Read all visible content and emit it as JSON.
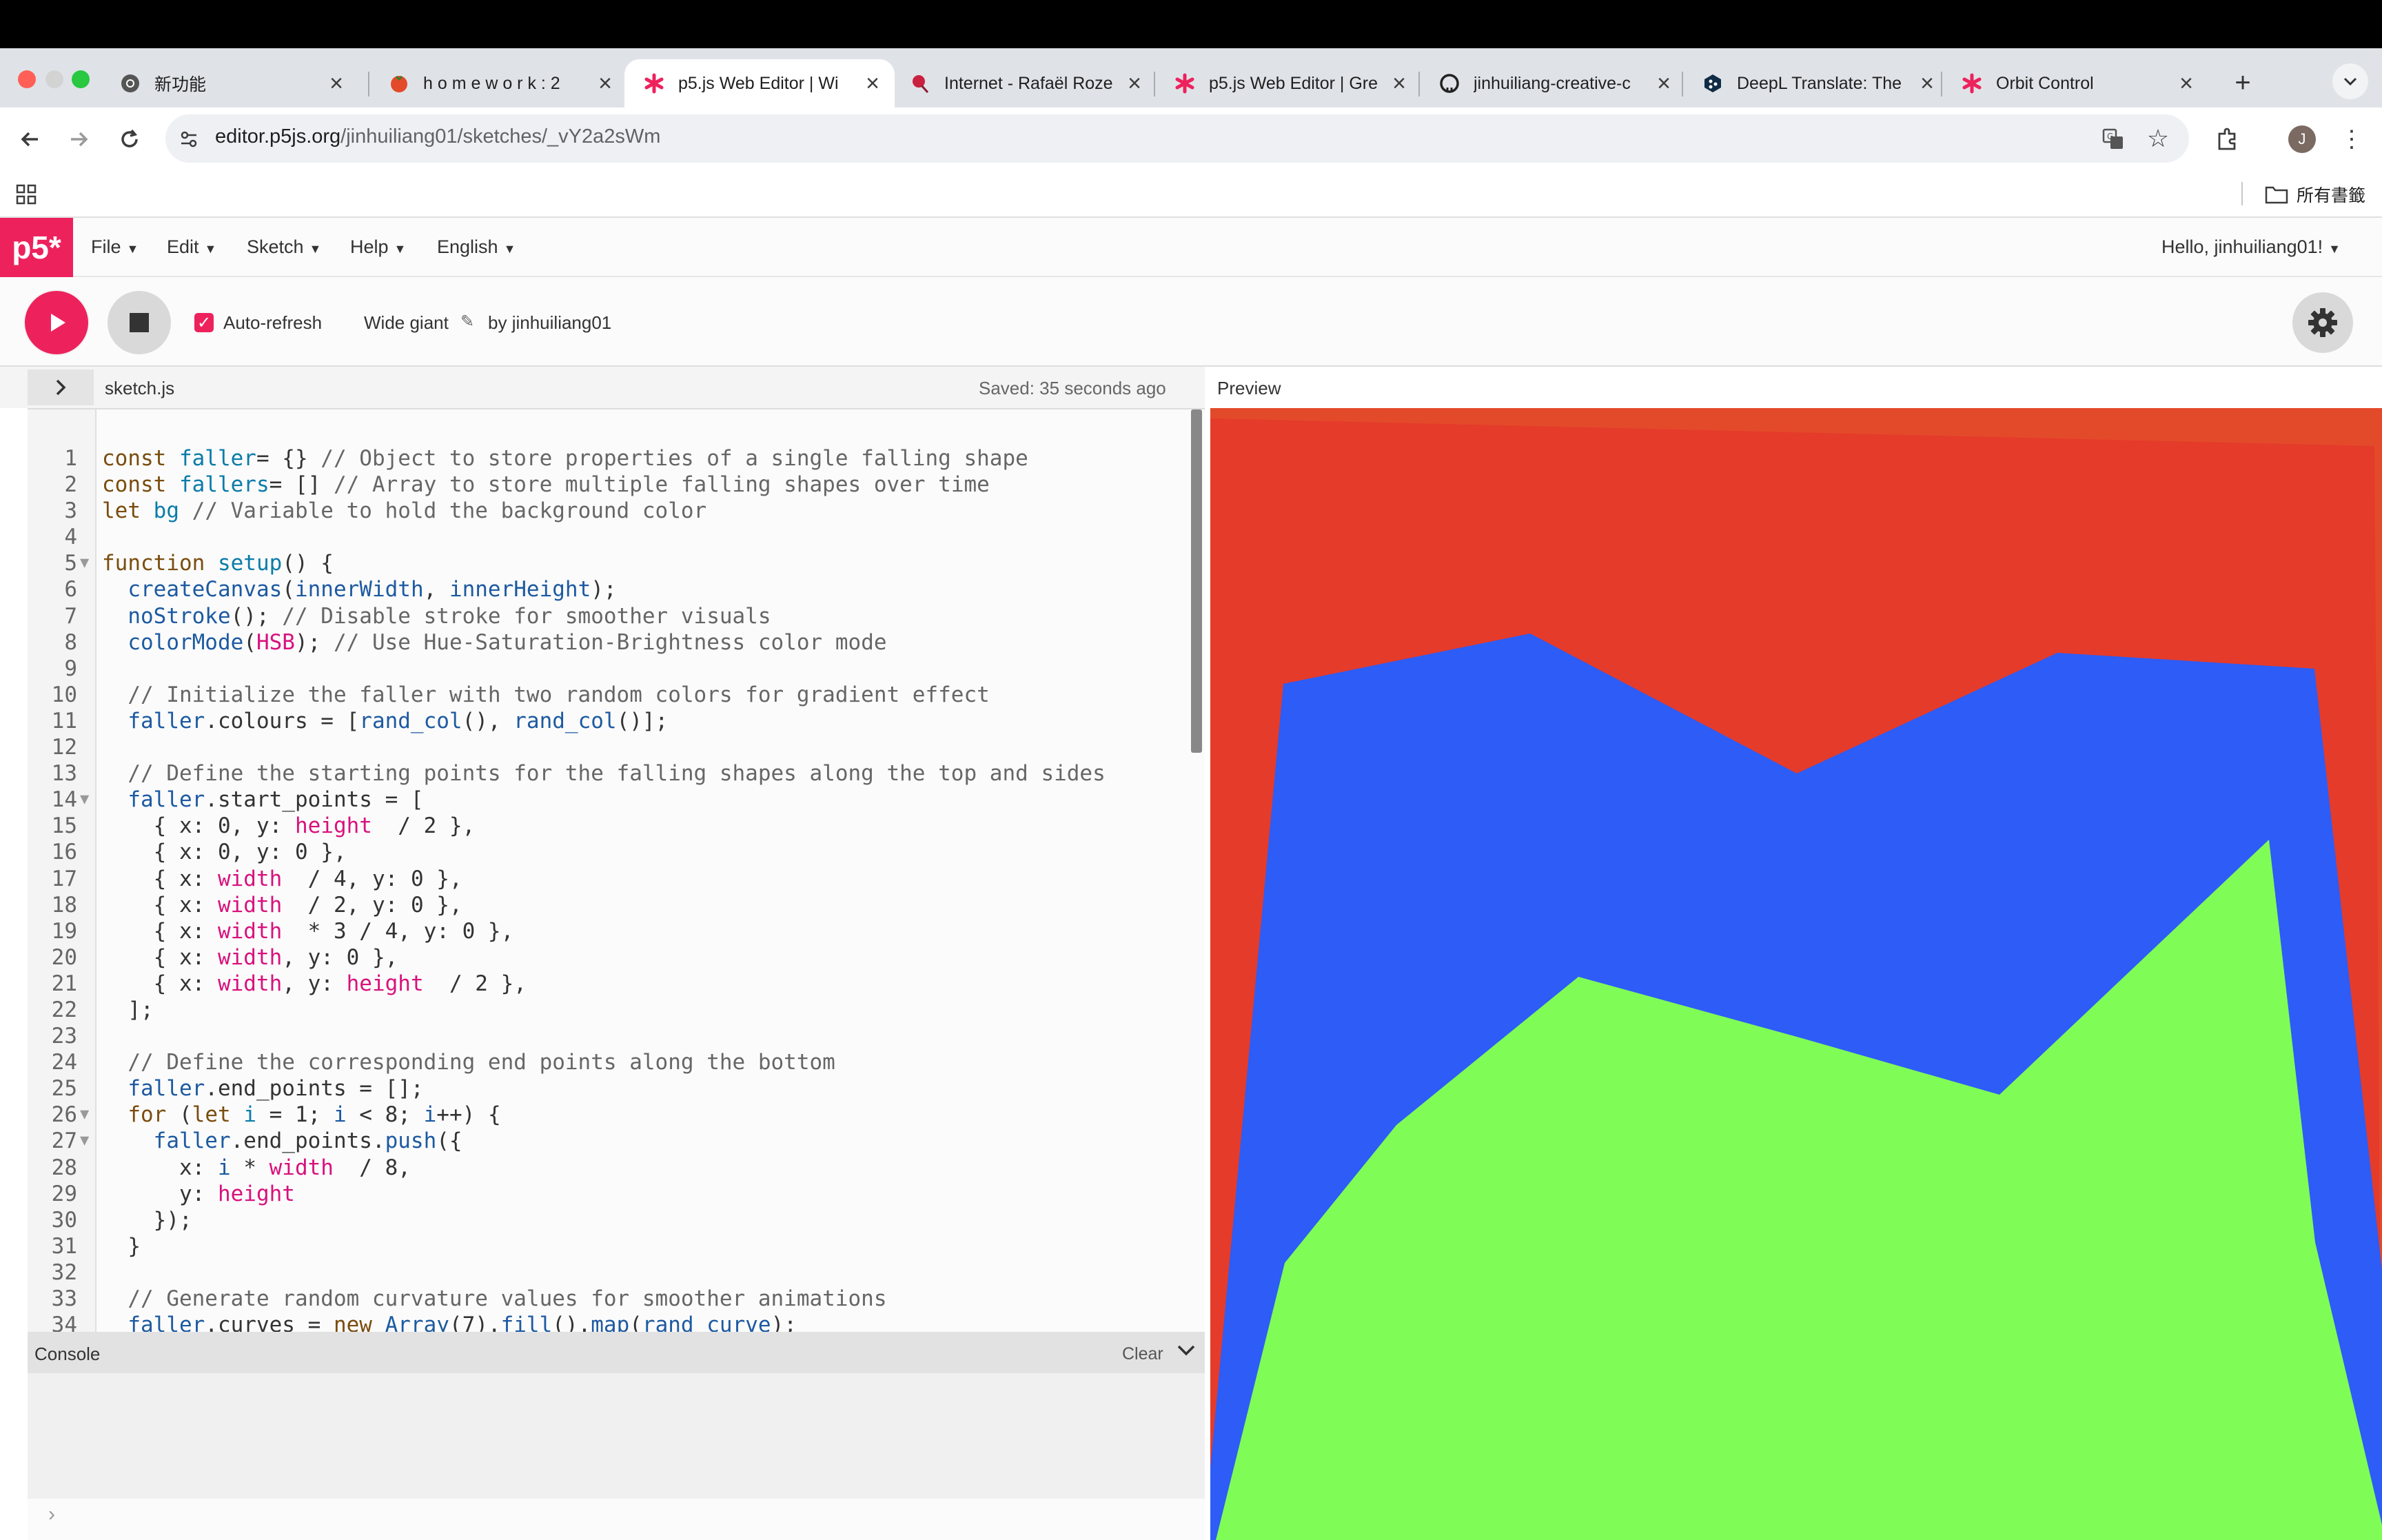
{
  "browser": {
    "tabs": [
      {
        "title": "新功能",
        "icon": "chrome-icon"
      },
      {
        "title": "h o m e w o r k : 2",
        "icon": "tomato-icon"
      },
      {
        "title": "p5.js Web Editor | Wi",
        "icon": "p5-asterisk-icon"
      },
      {
        "title": "Internet - Rafaël Roze",
        "icon": "rose-icon"
      },
      {
        "title": "p5.js Web Editor | Gre",
        "icon": "p5-asterisk-icon"
      },
      {
        "title": "jinhuiliang-creative-c",
        "icon": "github-icon"
      },
      {
        "title": "DeepL Translate: The",
        "icon": "deepl-icon"
      },
      {
        "title": "Orbit Control",
        "icon": "p5-asterisk-icon"
      }
    ],
    "active_tab_index": 2,
    "url_host": "editor.p5js.org",
    "url_path": "/jinhuiliang01/sketches/_vY2a2sWm",
    "bookmarks_label": "所有書籤",
    "profile_initial": "J",
    "colors": {
      "close": "#ff5f57",
      "minimize": "#d3d3d3",
      "maximize": "#28c840",
      "p5_pink": "#ed225d"
    }
  },
  "editor": {
    "logo": "p5*",
    "menus": [
      "File",
      "Edit",
      "Sketch",
      "Help",
      "English"
    ],
    "user_menu": "Hello, jinhuiliang01!",
    "auto_refresh_label": "Auto-refresh",
    "auto_refresh_checked": true,
    "sketch_name": "Wide giant",
    "by_label": "by",
    "author": "jinhuiliang01",
    "file_name": "sketch.js",
    "saved_status": "Saved: 35 seconds ago",
    "preview_label": "Preview",
    "console_label": "Console",
    "clear_label": "Clear",
    "fold_marker_lines": [
      5,
      14,
      26,
      27
    ],
    "code_lines": [
      [
        [
          "kw",
          "const "
        ],
        [
          "def",
          "faller"
        ],
        [
          "",
          "= {} "
        ],
        [
          "cm",
          "// Object to store properties of a single falling shape"
        ]
      ],
      [
        [
          "kw",
          "const "
        ],
        [
          "def",
          "fallers"
        ],
        [
          "",
          "= [] "
        ],
        [
          "cm",
          "// Array to store multiple falling shapes over time"
        ]
      ],
      [
        [
          "kw",
          "let "
        ],
        [
          "def",
          "bg "
        ],
        [
          "cm",
          "// Variable to hold the background color"
        ]
      ],
      [],
      [
        [
          "kw",
          "function "
        ],
        [
          "def",
          "setup"
        ],
        [
          "",
          "() {"
        ]
      ],
      [
        [
          "",
          "  "
        ],
        [
          "vr",
          "createCanvas"
        ],
        [
          "",
          "("
        ],
        [
          "vr",
          "innerWidth"
        ],
        [
          "",
          ", "
        ],
        [
          "vr",
          "innerHeight"
        ],
        [
          "",
          ");"
        ]
      ],
      [
        [
          "",
          "  "
        ],
        [
          "vr",
          "noStroke"
        ],
        [
          "",
          "(); "
        ],
        [
          "cm",
          "// Disable stroke for smoother visuals"
        ]
      ],
      [
        [
          "",
          "  "
        ],
        [
          "vr",
          "colorMode"
        ],
        [
          "",
          "("
        ],
        [
          "mg",
          "HSB"
        ],
        [
          "",
          "); "
        ],
        [
          "cm",
          "// Use Hue-Saturation-Brightness color mode"
        ]
      ],
      [],
      [
        [
          "",
          "  "
        ],
        [
          "cm",
          "// Initialize the faller with two random colors for gradient effect"
        ]
      ],
      [
        [
          "",
          "  "
        ],
        [
          "vr",
          "faller"
        ],
        [
          "",
          ".colours = ["
        ],
        [
          "vr",
          "rand_col"
        ],
        [
          "",
          "(), "
        ],
        [
          "vr",
          "rand_col"
        ],
        [
          "",
          "()];"
        ]
      ],
      [],
      [
        [
          "",
          "  "
        ],
        [
          "cm",
          "// Define the starting points for the falling shapes along the top and sides"
        ]
      ],
      [
        [
          "",
          "  "
        ],
        [
          "vr",
          "faller"
        ],
        [
          "",
          ".start_points = ["
        ]
      ],
      [
        [
          "",
          "    { x: 0, y: "
        ],
        [
          "mg",
          "height"
        ],
        [
          "",
          "  / 2 },"
        ]
      ],
      [
        [
          "",
          "    { x: 0, y: 0 },"
        ]
      ],
      [
        [
          "",
          "    { x: "
        ],
        [
          "mg",
          "width"
        ],
        [
          "",
          "  / 4, y: 0 },"
        ]
      ],
      [
        [
          "",
          "    { x: "
        ],
        [
          "mg",
          "width"
        ],
        [
          "",
          "  / 2, y: 0 },"
        ]
      ],
      [
        [
          "",
          "    { x: "
        ],
        [
          "mg",
          "width"
        ],
        [
          "",
          "  * 3 / 4, y: 0 },"
        ]
      ],
      [
        [
          "",
          "    { x: "
        ],
        [
          "mg",
          "width"
        ],
        [
          "",
          ", y: 0 },"
        ]
      ],
      [
        [
          "",
          "    { x: "
        ],
        [
          "mg",
          "width"
        ],
        [
          "",
          ", y: "
        ],
        [
          "mg",
          "height"
        ],
        [
          "",
          "  / 2 },"
        ]
      ],
      [
        [
          "",
          "  ];"
        ]
      ],
      [],
      [
        [
          "",
          "  "
        ],
        [
          "cm",
          "// Define the corresponding end points along the bottom"
        ]
      ],
      [
        [
          "",
          "  "
        ],
        [
          "vr",
          "faller"
        ],
        [
          "",
          ".end_points = [];"
        ]
      ],
      [
        [
          "",
          "  "
        ],
        [
          "kw",
          "for "
        ],
        [
          "",
          "("
        ],
        [
          "kw",
          "let "
        ],
        [
          "def",
          "i "
        ],
        [
          "",
          "= 1; "
        ],
        [
          "vr",
          "i "
        ],
        [
          "",
          "< 8; "
        ],
        [
          "vr",
          "i"
        ],
        [
          "",
          "++) {"
        ]
      ],
      [
        [
          "",
          "    "
        ],
        [
          "vr",
          "faller"
        ],
        [
          "",
          ".end_points."
        ],
        [
          "vr",
          "push"
        ],
        [
          "",
          "({"
        ]
      ],
      [
        [
          "",
          "      x: "
        ],
        [
          "vr",
          "i "
        ],
        [
          "",
          "* "
        ],
        [
          "mg",
          "width"
        ],
        [
          "",
          "  / 8,"
        ]
      ],
      [
        [
          "",
          "      y: "
        ],
        [
          "mg",
          "height"
        ]
      ],
      [
        [
          "",
          "    });"
        ]
      ],
      [
        [
          "",
          "  }"
        ]
      ],
      [],
      [
        [
          "",
          "  "
        ],
        [
          "cm",
          "// Generate random curvature values for smoother animations"
        ]
      ],
      [
        [
          "",
          "  "
        ],
        [
          "vr",
          "faller"
        ],
        [
          "",
          ".curves = "
        ],
        [
          "kw",
          "new "
        ],
        [
          "vr",
          "Array"
        ],
        [
          "",
          "(7)."
        ],
        [
          "vr",
          "fill"
        ],
        [
          "",
          "()."
        ],
        [
          "vr",
          "map"
        ],
        [
          "",
          "("
        ],
        [
          "vr",
          "rand_curve"
        ],
        [
          "",
          ");"
        ]
      ]
    ]
  },
  "preview": {
    "colors": {
      "background": "#e34a2a",
      "red_layer": "#e53b2b",
      "blue_layer": "#2d5cf6",
      "green_layer": "#80fc56"
    }
  }
}
